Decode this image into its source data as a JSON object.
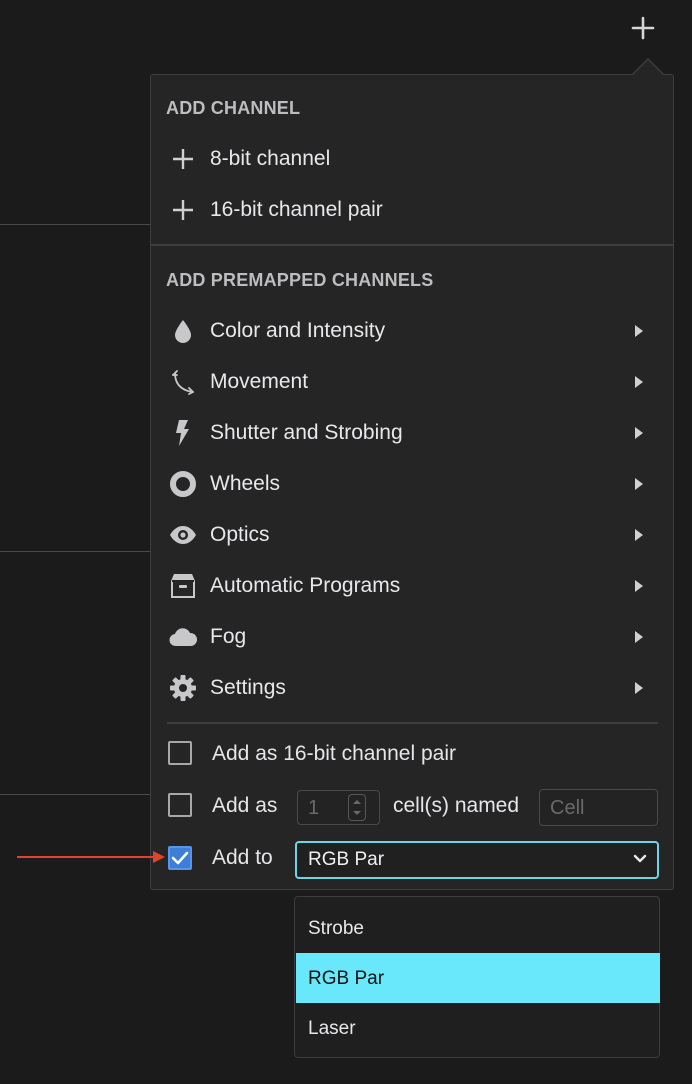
{
  "add_channel": {
    "title": "ADD CHANNEL",
    "items": [
      {
        "label": "8-bit channel",
        "icon": "plus-icon"
      },
      {
        "label": "16-bit channel pair",
        "icon": "plus-icon"
      }
    ]
  },
  "premapped": {
    "title": "ADD PREMAPPED CHANNELS",
    "items": [
      {
        "label": "Color and Intensity",
        "icon": "droplet-icon"
      },
      {
        "label": "Movement",
        "icon": "move-arrow-icon"
      },
      {
        "label": "Shutter and Strobing",
        "icon": "bolt-icon"
      },
      {
        "label": "Wheels",
        "icon": "ring-icon"
      },
      {
        "label": "Optics",
        "icon": "eye-icon"
      },
      {
        "label": "Automatic Programs",
        "icon": "box-icon"
      },
      {
        "label": "Fog",
        "icon": "cloud-icon"
      },
      {
        "label": "Settings",
        "icon": "gear-icon"
      }
    ]
  },
  "options": {
    "pair_label": "Add as 16-bit channel pair",
    "pair_checked": false,
    "addas_label": "Add as",
    "addas_checked": false,
    "count_value": "1",
    "cells_named_label": "cell(s) named",
    "cell_placeholder": "Cell",
    "addto_label": "Add to",
    "addto_checked": true,
    "addto_selected": "RGB Par"
  },
  "dropdown": {
    "options": [
      "Strobe",
      "RGB Par",
      "Laser"
    ],
    "selected": "RGB Par"
  },
  "colors": {
    "accent_focus": "#6fd4e3",
    "selected_option": "#68e8fa",
    "checkbox_checked": "#3c7ed8",
    "annotation_arrow": "#e0442f"
  }
}
